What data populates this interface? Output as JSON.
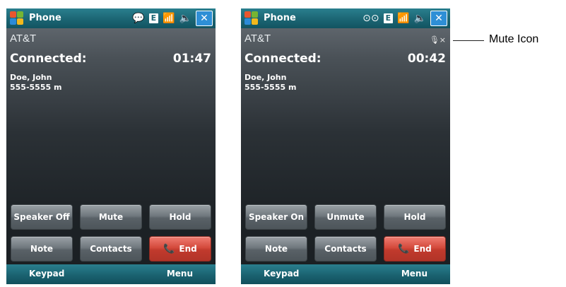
{
  "screens": [
    {
      "title": "Phone",
      "status_icons": [
        "speech-bubble-icon",
        "edge-data-icon",
        "signal-icon",
        "speaker-icon",
        "close-icon"
      ],
      "status_text": {
        "data": "E",
        "close": "✕"
      },
      "carrier": "AT&T",
      "mute_indicator": "",
      "connection_status": "Connected:",
      "timer": "01:47",
      "caller_name": "Doe, John",
      "caller_number": "555-5555 m",
      "buttons": {
        "speaker": "Speaker Off",
        "mute": "Mute",
        "hold": "Hold",
        "note": "Note",
        "contacts": "Contacts",
        "end": "End"
      },
      "softkeys": {
        "left": "Keypad",
        "right": "Menu"
      }
    },
    {
      "title": "Phone",
      "status_icons": [
        "voicemail-icon",
        "edge-data-icon",
        "signal-icon",
        "speaker-icon",
        "close-icon"
      ],
      "status_text": {
        "data": "E",
        "close": "✕"
      },
      "carrier": "AT&T",
      "mute_indicator": "🎙×",
      "connection_status": "Connected:",
      "timer": "00:42",
      "caller_name": "Doe, John",
      "caller_number": "555-5555 m",
      "buttons": {
        "speaker": "Speaker On",
        "mute": "Unmute",
        "hold": "Hold",
        "note": "Note",
        "contacts": "Contacts",
        "end": "End"
      },
      "softkeys": {
        "left": "Keypad",
        "right": "Menu"
      }
    }
  ],
  "callout": {
    "label": "Mute Icon"
  },
  "colors": {
    "titlebar": "#1b6573",
    "end_button": "#d44a3c",
    "close_button": "#2e8fd6"
  }
}
